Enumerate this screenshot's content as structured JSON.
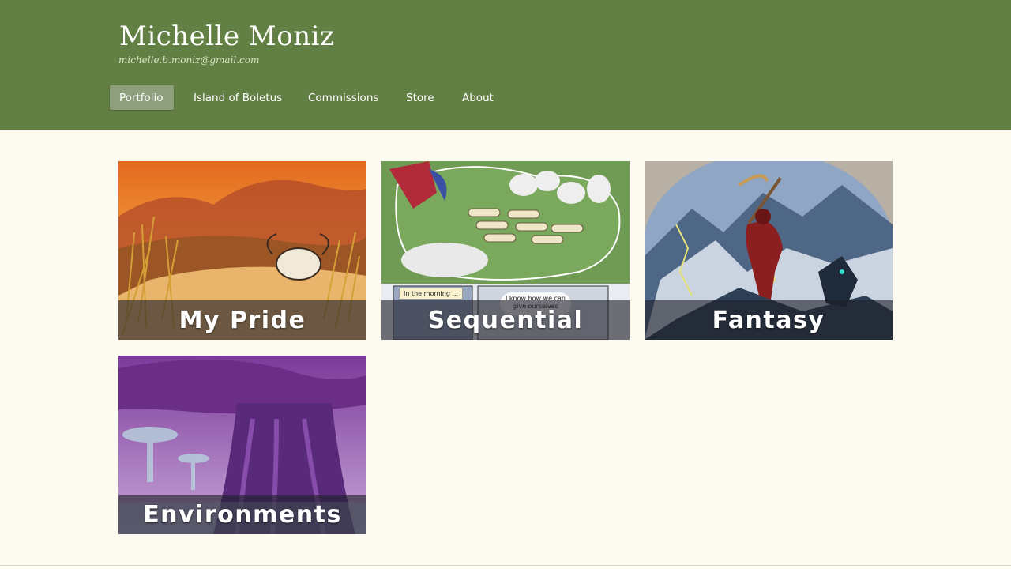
{
  "site": {
    "title": "Michelle Moniz",
    "email": "michelle.b.moniz@gmail.com"
  },
  "nav": {
    "items": [
      {
        "label": "Portfolio",
        "active": true
      },
      {
        "label": "Island of Boletus",
        "active": false
      },
      {
        "label": "Commissions",
        "active": false
      },
      {
        "label": "Store",
        "active": false
      },
      {
        "label": "About",
        "active": false
      }
    ]
  },
  "gallery": {
    "tiles": [
      {
        "caption": "My Pride"
      },
      {
        "caption": "Sequential",
        "bubble": "In the morning ...",
        "speech": "I know how we can give ourselves"
      },
      {
        "caption": "Fantasy"
      },
      {
        "caption": "Environments"
      }
    ]
  },
  "colors": {
    "header": "#627f44",
    "background": "#fdfbf1",
    "active_nav": "#8d9f7c"
  }
}
